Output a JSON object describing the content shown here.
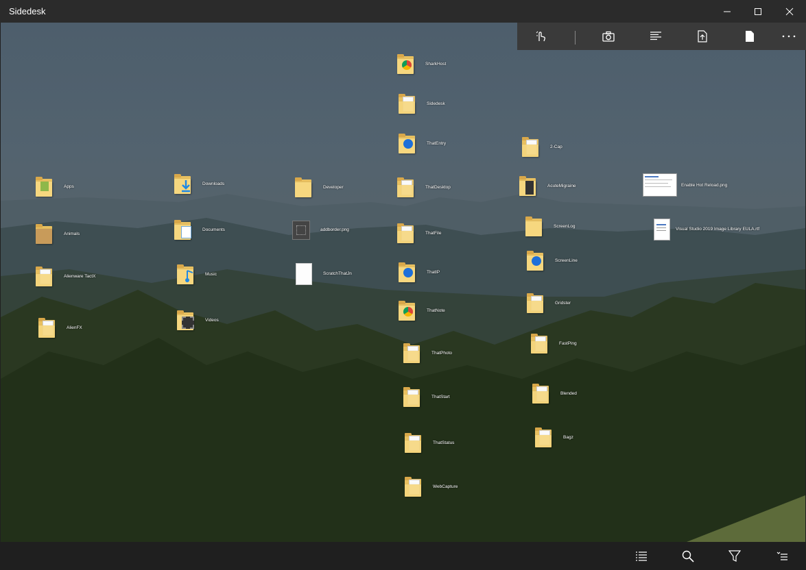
{
  "app": {
    "title": "Sidedesk"
  },
  "window_controls": [
    "minimize-icon",
    "maximize-icon",
    "close-icon"
  ],
  "toolbar": {
    "buttons": [
      "touch-mode-icon",
      "camera-icon",
      "text-align-icon",
      "export-file-icon",
      "page-icon",
      "more-icon"
    ]
  },
  "desktop_items": [
    {
      "label": "Apps",
      "type": "folder",
      "glyph": "green"
    },
    {
      "label": "Animals",
      "type": "folder",
      "glyph": "brown"
    },
    {
      "label": "Alienware TactX",
      "type": "folder",
      "glyph": "doc"
    },
    {
      "label": "AlienFX",
      "type": "folder",
      "glyph": "doc"
    },
    {
      "label": "Downloads",
      "type": "folder",
      "glyph": "download"
    },
    {
      "label": "Documents",
      "type": "folder",
      "glyph": "documents"
    },
    {
      "label": "Music",
      "type": "folder",
      "glyph": "music"
    },
    {
      "label": "Videos",
      "type": "folder",
      "glyph": "video"
    },
    {
      "label": "Developer",
      "type": "folder",
      "glyph": ""
    },
    {
      "label": "addborder.png",
      "type": "image",
      "glyph": ""
    },
    {
      "label": "ScratchThatJn",
      "type": "file",
      "glyph": ""
    },
    {
      "label": "SharkHost",
      "type": "folder",
      "glyph": "chrome"
    },
    {
      "label": "Sidedesk",
      "type": "folder",
      "glyph": "doc"
    },
    {
      "label": "ThatEntry",
      "type": "folder",
      "glyph": "blue"
    },
    {
      "label": "ThatDesktop",
      "type": "folder",
      "glyph": "doc"
    },
    {
      "label": "ThatFile",
      "type": "folder",
      "glyph": "doc"
    },
    {
      "label": "ThatIP",
      "type": "folder",
      "glyph": "blue"
    },
    {
      "label": "ThatNote",
      "type": "folder",
      "glyph": "chrome"
    },
    {
      "label": "ThatPhoto",
      "type": "folder",
      "glyph": "doc"
    },
    {
      "label": "ThatStart",
      "type": "folder",
      "glyph": "doc"
    },
    {
      "label": "ThatStatus",
      "type": "folder",
      "glyph": "doc"
    },
    {
      "label": "WebCapture",
      "type": "folder",
      "glyph": "doc"
    },
    {
      "label": "2-Cap",
      "type": "folder",
      "glyph": "doc"
    },
    {
      "label": "AcuteMigraine",
      "type": "folder",
      "glyph": "dark"
    },
    {
      "label": "ScreenLog",
      "type": "folder",
      "glyph": ""
    },
    {
      "label": "ScreenLine",
      "type": "folder",
      "glyph": "blue"
    },
    {
      "label": "Gridster",
      "type": "folder",
      "glyph": "doc"
    },
    {
      "label": "FastPing",
      "type": "folder",
      "glyph": "doc"
    },
    {
      "label": "Blended",
      "type": "folder",
      "glyph": "doc"
    },
    {
      "label": "Bagz",
      "type": "folder",
      "glyph": "doc"
    },
    {
      "label": "Enable Hot Reload.png",
      "type": "screenshot",
      "glyph": ""
    },
    {
      "label": "Visual Studio 2019 Image Library EULA.rtf",
      "type": "document",
      "glyph": ""
    }
  ],
  "bottombar": {
    "buttons": [
      "list-view-icon",
      "search-icon",
      "filter-icon",
      "sort-icon"
    ]
  }
}
